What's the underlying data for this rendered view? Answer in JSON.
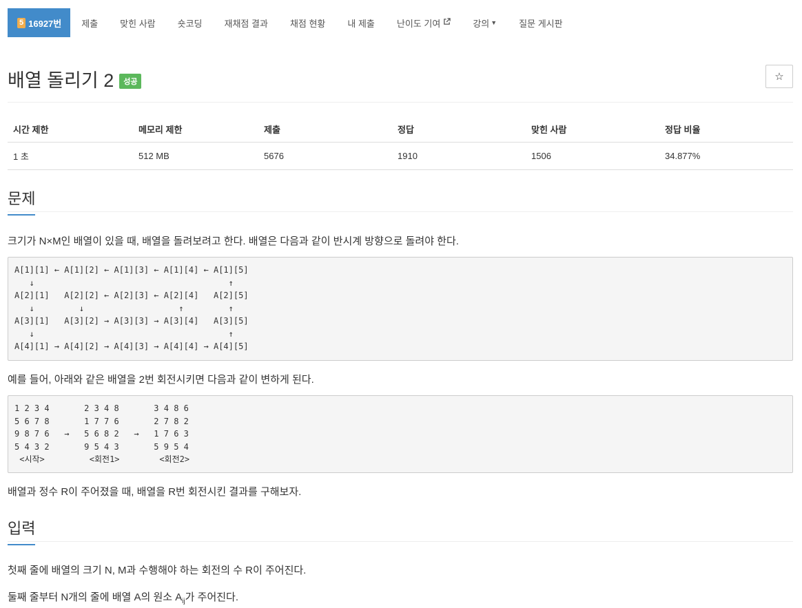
{
  "nav": {
    "problem_badge": "5",
    "problem_id": "16927번",
    "items": [
      {
        "label": "제출"
      },
      {
        "label": "맞힌 사람"
      },
      {
        "label": "숏코딩"
      },
      {
        "label": "재채점 결과"
      },
      {
        "label": "채점 현황"
      },
      {
        "label": "내 제출"
      },
      {
        "label": "난이도 기여"
      },
      {
        "label": "강의"
      },
      {
        "label": "질문 게시판"
      }
    ]
  },
  "problem": {
    "title": "배열 돌리기 2",
    "status": "성공",
    "star": "☆"
  },
  "stats": {
    "headers": [
      "시간 제한",
      "메모리 제한",
      "제출",
      "정답",
      "맞힌 사람",
      "정답 비율"
    ],
    "values": [
      "1 초",
      "512 MB",
      "5676",
      "1910",
      "1506",
      "34.877%"
    ]
  },
  "sections": {
    "problem_heading": "문제",
    "input_heading": "입력"
  },
  "content": {
    "intro": "크기가 N×M인 배열이 있을 때, 배열을 돌려보려고 한다. 배열은 다음과 같이 반시계 방향으로 돌려야 한다.",
    "diagram": "A[1][1] ← A[1][2] ← A[1][3] ← A[1][4] ← A[1][5]\n   ↓                                       ↑\nA[2][1]   A[2][2] ← A[2][3] ← A[2][4]   A[2][5]\n   ↓         ↓                   ↑         ↑\nA[3][1]   A[3][2] → A[3][3] → A[3][4]   A[3][5]\n   ↓                                       ↑\nA[4][1] → A[4][2] → A[4][3] → A[4][4] → A[4][5]",
    "example_intro": "예를 들어, 아래와 같은 배열을 2번 회전시키면 다음과 같이 변하게 된다.",
    "example": "1 2 3 4       2 3 4 8       3 4 8 6\n5 6 7 8       1 7 7 6       2 7 8 2\n9 8 7 6   →   5 6 8 2   →   1 7 6 3\n5 4 3 2       9 5 4 3       5 9 5 4\n <시작>         <회전1>        <회전2>",
    "task": "배열과 정수 R이 주어졌을 때, 배열을 R번 회전시킨 결과를 구해보자.",
    "input_line1": "첫째 줄에 배열의 크기 N, M과 수행해야 하는 회전의 수 R이 주어진다.",
    "input_line2_pre": "둘째 줄부터 N개의 줄에 배열 A의 원소 A",
    "input_line2_sub": "ij",
    "input_line2_post": "가 주어진다."
  }
}
